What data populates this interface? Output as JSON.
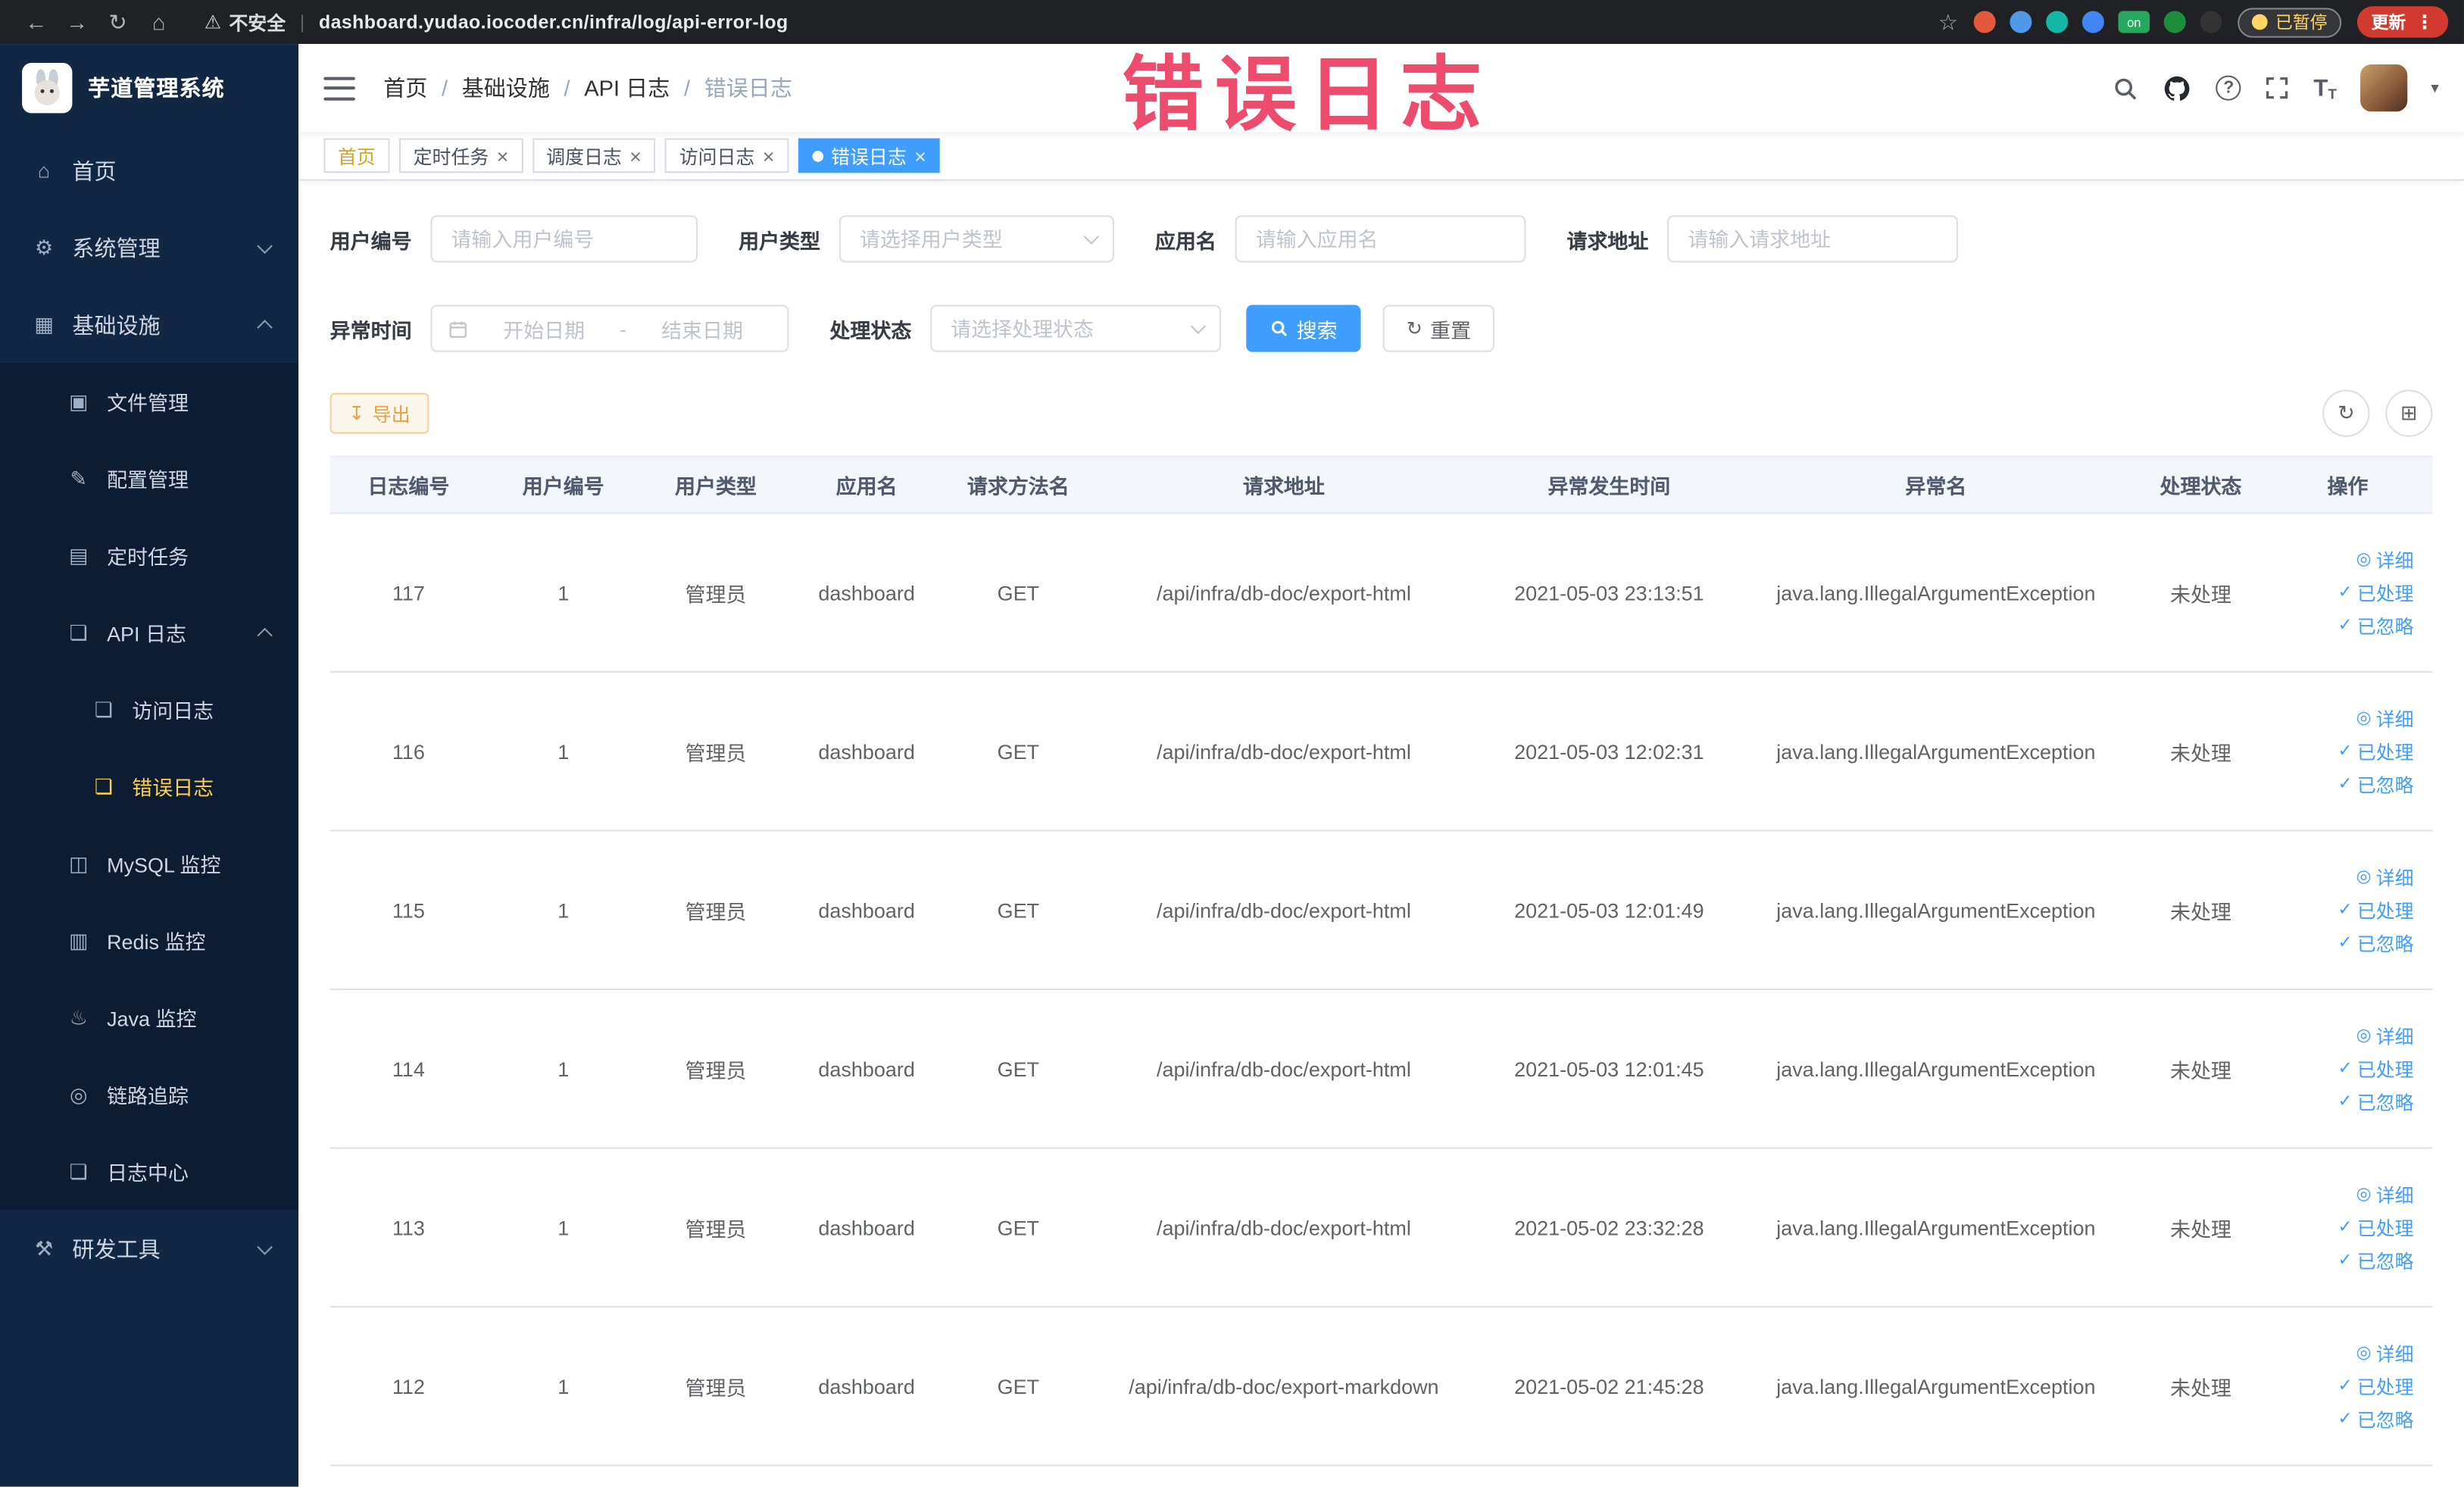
{
  "annotation": {
    "text": "错误日志"
  },
  "browser": {
    "security_label": "不安全",
    "url": "dashboard.yudao.iocoder.cn/infra/log/api-error-log",
    "paused_badge": "已暂停",
    "update_button": "更新",
    "extensions": [
      {
        "color": "#e4593c"
      },
      {
        "color": "#4e9bea"
      },
      {
        "color": "#12b7a5"
      },
      {
        "color": "#4285f4"
      },
      {
        "color": "#27a85f",
        "text": "on"
      },
      {
        "color": "#1e8e3e"
      },
      {
        "color": "#333333"
      }
    ]
  },
  "sidebar": {
    "logo_title": "芋道管理系统",
    "items": [
      {
        "label": "首页",
        "icon": "home",
        "level": 1
      },
      {
        "label": "系统管理",
        "icon": "system",
        "level": 1,
        "chevron": "down"
      },
      {
        "label": "基础设施",
        "icon": "infra",
        "level": 1,
        "chevron": "up"
      },
      {
        "label": "文件管理",
        "icon": "file",
        "level": 2
      },
      {
        "label": "配置管理",
        "icon": "config",
        "level": 2
      },
      {
        "label": "定时任务",
        "icon": "job",
        "level": 2
      },
      {
        "label": "API 日志",
        "icon": "api-log",
        "level": 2,
        "chevron": "up"
      },
      {
        "label": "访问日志",
        "icon": "access-log",
        "level": 3
      },
      {
        "label": "错误日志",
        "icon": "error-log",
        "level": 3,
        "active": true
      },
      {
        "label": "MySQL 监控",
        "icon": "mysql",
        "level": 2
      },
      {
        "label": "Redis 监控",
        "icon": "redis",
        "level": 2
      },
      {
        "label": "Java 监控",
        "icon": "java",
        "level": 2
      },
      {
        "label": "链路追踪",
        "icon": "trace",
        "level": 2
      },
      {
        "label": "日志中心",
        "icon": "log-center",
        "level": 2
      },
      {
        "label": "研发工具",
        "icon": "tool",
        "level": 1,
        "chevron": "down"
      }
    ],
    "icon_glyphs": {
      "home": "⌂",
      "system": "⚙",
      "infra": "▦",
      "file": "▣",
      "config": "✎",
      "job": "▤",
      "api-log": "❏",
      "access-log": "❏",
      "error-log": "❏",
      "mysql": "◫",
      "redis": "▥",
      "java": "♨",
      "trace": "◎",
      "log-center": "❏",
      "tool": "⚒"
    }
  },
  "header": {
    "breadcrumb": [
      "首页",
      "基础设施",
      "API 日志",
      "错误日志"
    ]
  },
  "tabs": [
    {
      "label": "首页",
      "closable": false,
      "affix": true
    },
    {
      "label": "定时任务",
      "closable": true
    },
    {
      "label": "调度日志",
      "closable": true
    },
    {
      "label": "访问日志",
      "closable": true
    },
    {
      "label": "错误日志",
      "closable": true,
      "active": true
    }
  ],
  "filters": {
    "user_id_label": "用户编号",
    "user_id_placeholder": "请输入用户编号",
    "user_type_label": "用户类型",
    "user_type_placeholder": "请选择用户类型",
    "app_name_label": "应用名",
    "app_name_placeholder": "请输入应用名",
    "request_url_label": "请求地址",
    "request_url_placeholder": "请输入请求地址",
    "exception_time_label": "异常时间",
    "start_date_placeholder": "开始日期",
    "date_separator": "-",
    "end_date_placeholder": "结束日期",
    "process_status_label": "处理状态",
    "process_status_placeholder": "请选择处理状态",
    "search_button": "搜索",
    "reset_button": "重置"
  },
  "toolbar": {
    "export_button": "导出"
  },
  "table": {
    "columns": [
      "日志编号",
      "用户编号",
      "用户类型",
      "应用名",
      "请求方法名",
      "请求地址",
      "异常发生时间",
      "异常名",
      "处理状态",
      "操作"
    ],
    "actions": [
      {
        "label": "详细",
        "name": "detail-action",
        "icon_name": "eye-icon",
        "glyph": "◎"
      },
      {
        "label": "已处理",
        "name": "mark-processed-action",
        "icon_name": "check-icon",
        "glyph": "✓"
      },
      {
        "label": "已忽略",
        "name": "mark-ignored-action",
        "icon_name": "check-icon",
        "glyph": "✓"
      }
    ],
    "rows": [
      {
        "log_id": "117",
        "user_id": "1",
        "user_type": "管理员",
        "app_name": "dashboard",
        "method": "GET",
        "request_url": "/api/infra/db-doc/export-html",
        "time": "2021-05-03 23:13:51",
        "exception": "java.lang.IllegalArgumentException",
        "status": "未处理"
      },
      {
        "log_id": "116",
        "user_id": "1",
        "user_type": "管理员",
        "app_name": "dashboard",
        "method": "GET",
        "request_url": "/api/infra/db-doc/export-html",
        "time": "2021-05-03 12:02:31",
        "exception": "java.lang.IllegalArgumentException",
        "status": "未处理"
      },
      {
        "log_id": "115",
        "user_id": "1",
        "user_type": "管理员",
        "app_name": "dashboard",
        "method": "GET",
        "request_url": "/api/infra/db-doc/export-html",
        "time": "2021-05-03 12:01:49",
        "exception": "java.lang.IllegalArgumentException",
        "status": "未处理"
      },
      {
        "log_id": "114",
        "user_id": "1",
        "user_type": "管理员",
        "app_name": "dashboard",
        "method": "GET",
        "request_url": "/api/infra/db-doc/export-html",
        "time": "2021-05-03 12:01:45",
        "exception": "java.lang.IllegalArgumentException",
        "status": "未处理"
      },
      {
        "log_id": "113",
        "user_id": "1",
        "user_type": "管理员",
        "app_name": "dashboard",
        "method": "GET",
        "request_url": "/api/infra/db-doc/export-html",
        "time": "2021-05-02 23:32:28",
        "exception": "java.lang.IllegalArgumentException",
        "status": "未处理"
      },
      {
        "log_id": "112",
        "user_id": "1",
        "user_type": "管理员",
        "app_name": "dashboard",
        "method": "GET",
        "request_url": "/api/infra/db-doc/export-markdown",
        "time": "2021-05-02 21:45:28",
        "exception": "java.lang.IllegalArgumentException",
        "status": "未处理"
      }
    ]
  }
}
